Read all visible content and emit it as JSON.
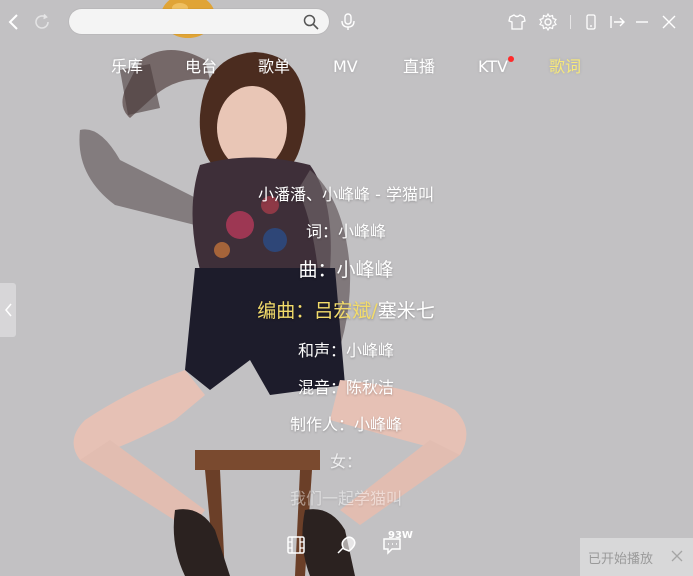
{
  "colors": {
    "active_tab": "#f7e97a",
    "highlight": "#f3dc6a",
    "badge": "#ff2a2a",
    "background": "#c2c1c3"
  },
  "search": {
    "value": "",
    "placeholder": ""
  },
  "nav": {
    "items": [
      {
        "label": "乐库"
      },
      {
        "label": "电台"
      },
      {
        "label": "歌单"
      },
      {
        "label": "MV"
      },
      {
        "label": "直播"
      },
      {
        "label": "KTV",
        "badge": true
      },
      {
        "label": "歌词",
        "active": true
      }
    ]
  },
  "lyrics": {
    "lines": [
      {
        "text": "小潘潘、小峰峰 - 学猫叫"
      },
      {
        "text": "词：小峰峰"
      },
      {
        "text": "曲：小峰峰"
      },
      {
        "text_hl": "编曲：吕宏斌/",
        "text": "塞米七"
      },
      {
        "text": "和声：小峰峰"
      },
      {
        "text": "混音：陈秋洁"
      },
      {
        "text": "制作人：小峰峰"
      },
      {
        "text": "女："
      },
      {
        "text": "我们一起学猫叫"
      }
    ]
  },
  "bottom": {
    "comment_count": "93W"
  },
  "toast": {
    "text": "已开始播放"
  },
  "icons": {
    "back": "chevron-left-icon",
    "refresh": "refresh-icon",
    "search": "search-icon",
    "mic": "microphone-icon",
    "skin": "shirt-icon",
    "settings": "gear-icon",
    "mini": "phone-icon",
    "mode": "mini-mode-icon",
    "minimize": "minimize-icon",
    "close": "close-icon",
    "mv": "film-icon",
    "favorite": "like-icon",
    "comment": "comment-icon"
  }
}
